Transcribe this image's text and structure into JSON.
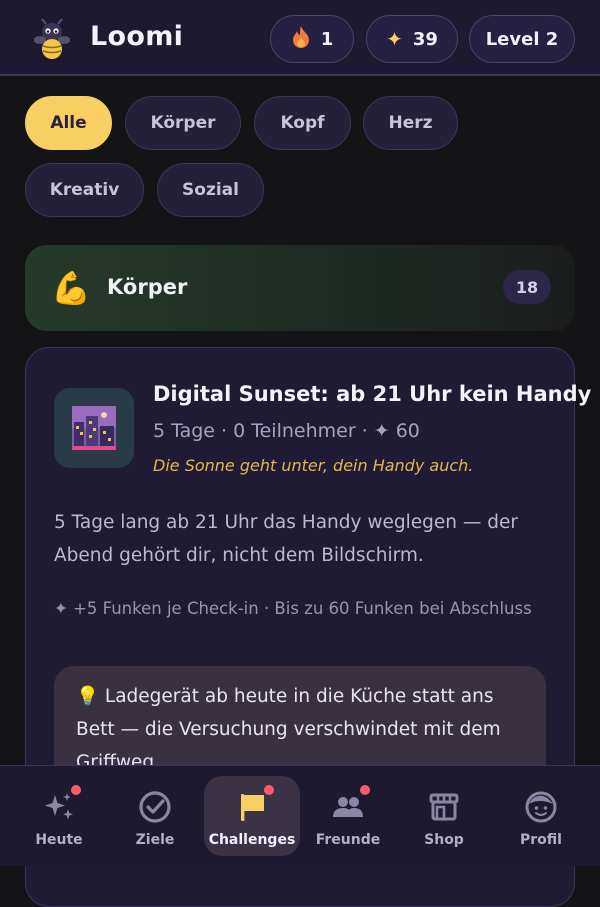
{
  "header": {
    "app_title": "Loomi",
    "streak": "1",
    "sparks": "39",
    "level": "Level 2"
  },
  "filters": [
    {
      "label": "Alle",
      "active": true
    },
    {
      "label": "Körper",
      "active": false
    },
    {
      "label": "Kopf",
      "active": false
    },
    {
      "label": "Herz",
      "active": false
    },
    {
      "label": "Kreativ",
      "active": false
    },
    {
      "label": "Sozial",
      "active": false
    }
  ],
  "section": {
    "emoji": "💪",
    "title": "Körper",
    "count": "18"
  },
  "challenge": {
    "title": "Digital Sunset: ab 21 Uhr kein Handy",
    "meta": "5 Tage · 0 Teilnehmer · ✦ 60",
    "tagline": "Die Sonne geht unter, dein Handy auch.",
    "description": "5 Tage lang ab 21 Uhr das Handy weglegen — der Abend gehört dir, nicht dem Bildschirm.",
    "reward": "✦ +5 Funken je Check-in · Bis zu 60 Funken bei Abschluss",
    "tip": "💡 Ladegerät ab heute in die Küche statt ans Bett — die Versuchung verschwindet mit dem Griffweg."
  },
  "nav": [
    {
      "label": "Heute",
      "icon": "sparkles-icon",
      "badge": true,
      "active": false
    },
    {
      "label": "Ziele",
      "icon": "check-circle-icon",
      "badge": false,
      "active": false
    },
    {
      "label": "Challenges",
      "icon": "flag-icon",
      "badge": true,
      "active": true
    },
    {
      "label": "Freunde",
      "icon": "friends-icon",
      "badge": true,
      "active": false
    },
    {
      "label": "Shop",
      "icon": "shop-icon",
      "badge": false,
      "active": false
    },
    {
      "label": "Profil",
      "icon": "profile-icon",
      "badge": false,
      "active": false
    }
  ],
  "colors": {
    "accent": "#f7cf63",
    "background": "#141316",
    "card": "#1f1b34",
    "badge": "#ff5a6a"
  }
}
